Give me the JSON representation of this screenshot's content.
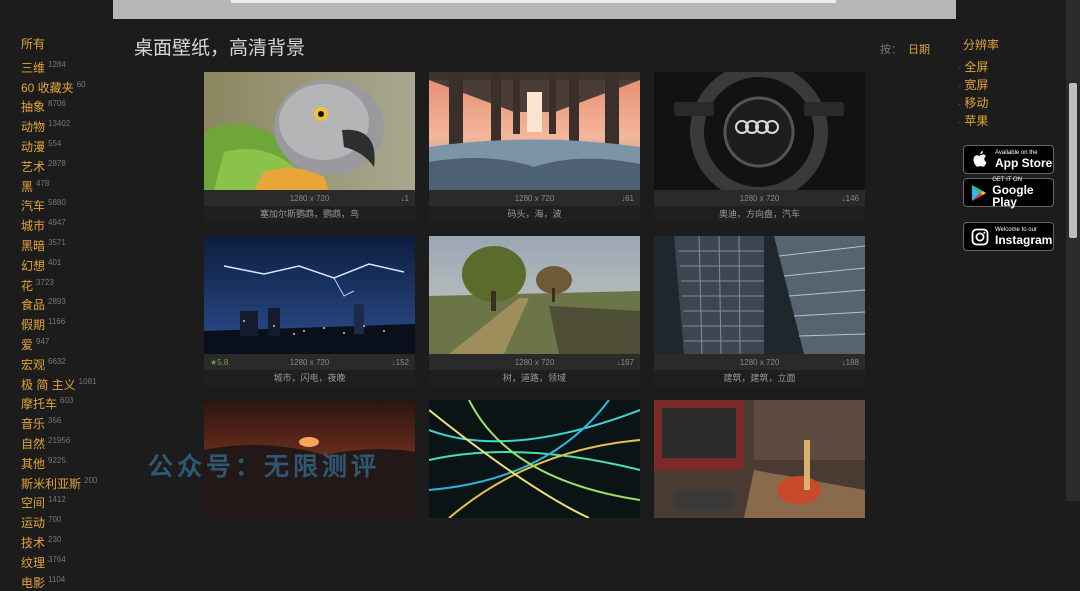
{
  "header": {
    "title": "桌面壁纸，高清背景",
    "sort_prefix": "按：",
    "sort_active": "日期"
  },
  "sidebar_left": {
    "all_label": "所有",
    "categories": [
      {
        "label": "三维",
        "count": "1284"
      },
      {
        "label": "60 收藏夹",
        "count": "60"
      },
      {
        "label": "抽象",
        "count": "8706"
      },
      {
        "label": "动物",
        "count": "13402"
      },
      {
        "label": "动漫",
        "count": "554"
      },
      {
        "label": "艺术",
        "count": "2878"
      },
      {
        "label": "黑",
        "count": "478"
      },
      {
        "label": "汽车",
        "count": "5880"
      },
      {
        "label": "城市",
        "count": "4947"
      },
      {
        "label": "黑暗",
        "count": "3571"
      },
      {
        "label": "幻想",
        "count": "401"
      },
      {
        "label": "花",
        "count": "3723"
      },
      {
        "label": "食品",
        "count": "2893"
      },
      {
        "label": "假期",
        "count": "1166"
      },
      {
        "label": "爱",
        "count": "947"
      },
      {
        "label": "宏观",
        "count": "6632"
      },
      {
        "label": "极 简 主义",
        "count": "1081"
      },
      {
        "label": "摩托车",
        "count": "603"
      },
      {
        "label": "音乐",
        "count": "356"
      },
      {
        "label": "自然",
        "count": "21956"
      },
      {
        "label": "其他",
        "count": "9225"
      },
      {
        "label": "斯米利亚斯",
        "count": "200"
      },
      {
        "label": "空间",
        "count": "1412"
      },
      {
        "label": "运动",
        "count": "700"
      },
      {
        "label": "技术",
        "count": "230"
      },
      {
        "label": "纹理",
        "count": "3764"
      },
      {
        "label": "电影",
        "count": "1104"
      }
    ]
  },
  "sidebar_right": {
    "head": "分辨率",
    "items": [
      "全屏",
      "宽屏",
      "移动",
      "苹果"
    ],
    "stores": [
      {
        "small": "Available on the",
        "big": "App Store"
      },
      {
        "small": "GET IT ON",
        "big": "Google Play"
      },
      {
        "small": "Welcome to our",
        "big": "Instagram"
      }
    ]
  },
  "wallpapers": [
    {
      "res": "1280 x 720",
      "downloads": "1",
      "tags": "塞加尔斯鹦鹉，鹦鹉，鸟",
      "rating": ""
    },
    {
      "res": "1280 x 720",
      "downloads": "61",
      "tags": "码头，海，波",
      "rating": ""
    },
    {
      "res": "1280 x 720",
      "downloads": "146",
      "tags": "奥迪，方向盘，汽车",
      "rating": ""
    },
    {
      "res": "1280 x 720",
      "downloads": "152",
      "tags": "城市，闪电，夜晚",
      "rating": "5.8"
    },
    {
      "res": "1280 x 720",
      "downloads": "167",
      "tags": "树，道路，领域",
      "rating": ""
    },
    {
      "res": "1280 x 720",
      "downloads": "188",
      "tags": "建筑，建筑，立面",
      "rating": ""
    },
    {
      "res": "",
      "downloads": "",
      "tags": "",
      "rating": ""
    },
    {
      "res": "",
      "downloads": "",
      "tags": "",
      "rating": ""
    },
    {
      "res": "",
      "downloads": "",
      "tags": "",
      "rating": ""
    }
  ],
  "watermark": "公众号：无限测评"
}
